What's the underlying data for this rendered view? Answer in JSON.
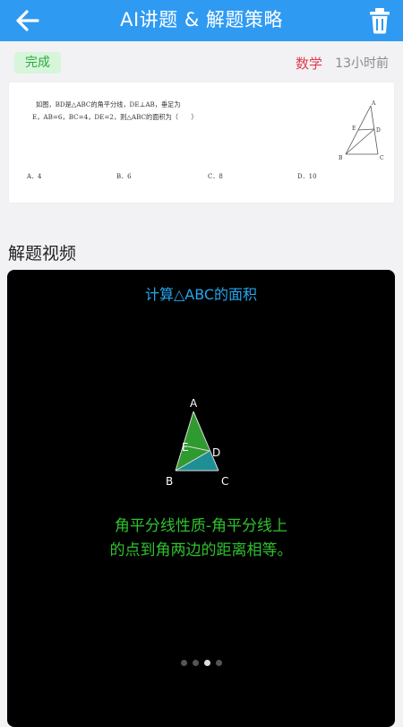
{
  "header": {
    "title": "AI讲题 & 解题策略",
    "back_icon": "arrow-left-icon",
    "delete_icon": "trash-icon",
    "bg_color": "#2f9af2"
  },
  "status": {
    "badge": "完成",
    "subject": "数学",
    "time": "13小时前",
    "badge_color": "#2daa3e",
    "subject_color": "#e23a4c"
  },
  "question": {
    "line1": "如图，BD是△ABC的角平分线，DE⊥AB，垂足为",
    "line2": "E，AB=6，BC=4，DE=2，则△ABC的面积为（　　）",
    "options": [
      "A．4",
      "B．6",
      "C．8",
      "D．10"
    ],
    "figure_labels": {
      "A": "A",
      "B": "B",
      "C": "C",
      "D": "D",
      "E": "E"
    }
  },
  "section": {
    "title": "解题视频"
  },
  "video": {
    "title": "计算△ABC的面积",
    "caption_line1": "角平分线性质-角平分线上",
    "caption_line2": "的点到角两边的距离相等。",
    "figure_labels": {
      "A": "A",
      "B": "B",
      "C": "C",
      "D": "D",
      "E": "E"
    },
    "pager_total": 4,
    "pager_active": 3,
    "title_color": "#25a6ee",
    "caption_color": "#2ec22e"
  }
}
